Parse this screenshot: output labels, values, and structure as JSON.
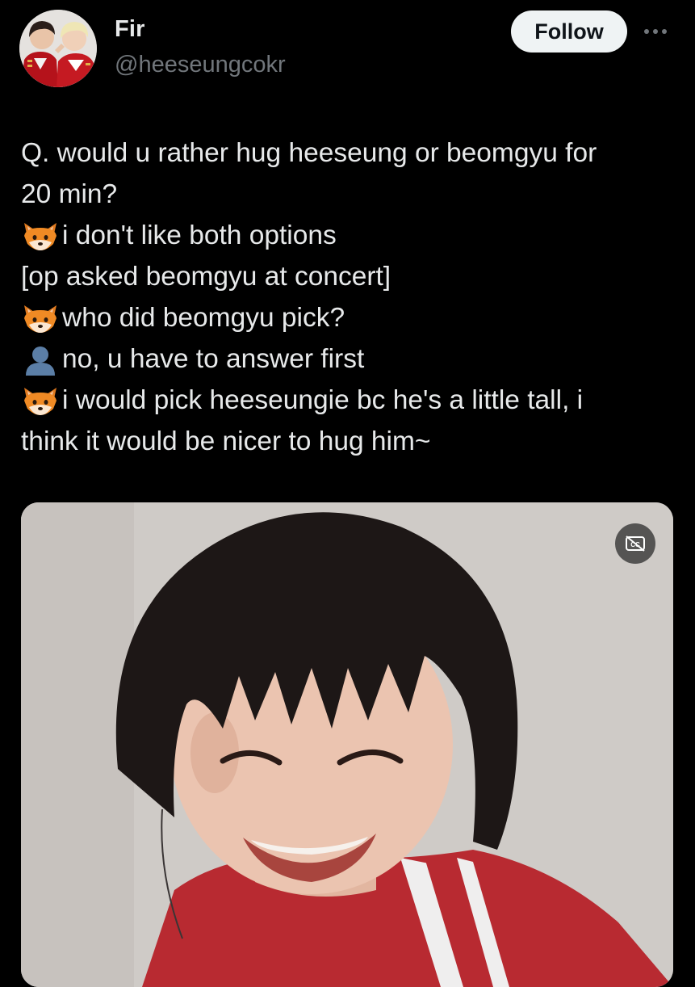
{
  "author": {
    "display_name": "Fir",
    "handle": "@heeseungcokr",
    "avatar_icon": "profile-photo-two-people"
  },
  "actions": {
    "follow_label": "Follow",
    "more_icon": "more-horizontal-icon"
  },
  "tweet": {
    "lines": [
      {
        "emoji": null,
        "text": "Q. would u rather hug heeseung or beomgyu for"
      },
      {
        "emoji": null,
        "text": "20 min?"
      },
      {
        "emoji": "fox-emoji",
        "text": "i don't like both options"
      },
      {
        "emoji": null,
        "text": "[op asked beomgyu at concert]"
      },
      {
        "emoji": "fox-emoji",
        "text": "who did beomgyu pick?"
      },
      {
        "emoji": "bust-silhouette-emoji",
        "text": "no, u have to answer first"
      },
      {
        "emoji": "fox-emoji",
        "text": "i would pick heeseungie bc he's a little tall, i"
      },
      {
        "emoji": null,
        "text": "think it would be nicer to hug him~"
      }
    ]
  },
  "media": {
    "type": "video",
    "content": "photo of a smiling young man with dark fringe hair wearing a red and white varsity jacket",
    "captions_icon": "closed-captions-off-icon"
  },
  "colors": {
    "background": "#000000",
    "text_primary": "#e7e9ea",
    "text_secondary": "#71767b",
    "follow_button_bg": "#eff3f4",
    "follow_button_text": "#0f1419"
  }
}
